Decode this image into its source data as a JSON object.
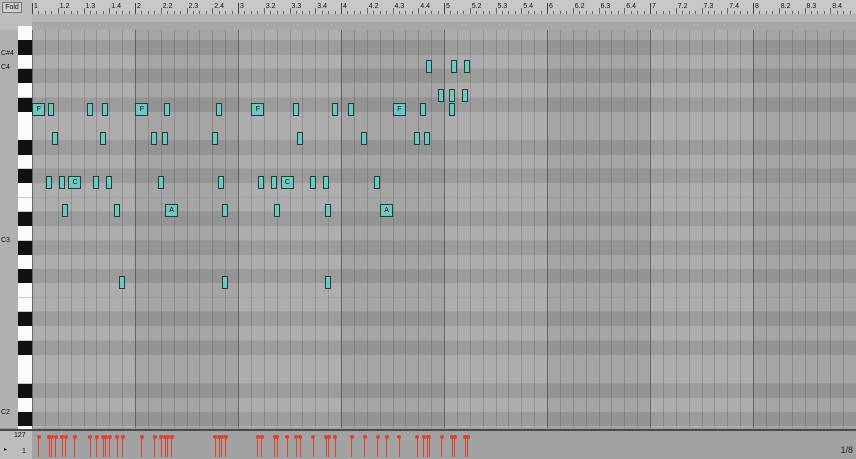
{
  "toolbar": {
    "fold_label": "Fold"
  },
  "ruler": {
    "labels": [
      "1",
      "1.2",
      "1.3",
      "1.4",
      "2",
      "2.2",
      "2.3",
      "2.4",
      "3",
      "3.2",
      "3.3",
      "3.4",
      "4",
      "4.2",
      "4.3",
      "4.4",
      "5",
      "5.2",
      "5.3",
      "5.4",
      "6",
      "6.2",
      "6.3",
      "6.4",
      "7",
      "7.2",
      "7.3",
      "7.4",
      "8",
      "8.2",
      "8.3",
      "8.4"
    ]
  },
  "loop_marker": "+",
  "keyboard": {
    "labels": [
      "C#4",
      "C4",
      "C3",
      "C2"
    ]
  },
  "notes": [
    {
      "beat": 1.25,
      "row": 4,
      "label": "F"
    },
    {
      "beat": 1.75,
      "row": 4,
      "label": ""
    },
    {
      "beat": 3.25,
      "row": 4,
      "label": ""
    },
    {
      "beat": 3.85,
      "row": 4,
      "label": ""
    },
    {
      "beat": 5.25,
      "row": 4,
      "label": "F"
    },
    {
      "beat": 6.25,
      "row": 4,
      "label": ""
    },
    {
      "beat": 8.25,
      "row": 4,
      "label": ""
    },
    {
      "beat": 9.75,
      "row": 4,
      "label": "F"
    },
    {
      "beat": 11.25,
      "row": 4,
      "label": ""
    },
    {
      "beat": 12.75,
      "row": 4,
      "label": ""
    },
    {
      "beat": 13.4,
      "row": 4,
      "label": ""
    },
    {
      "beat": 15.25,
      "row": 4,
      "label": "F"
    },
    {
      "beat": 16.2,
      "row": 4,
      "label": ""
    },
    {
      "beat": 17.3,
      "row": 4,
      "label": ""
    },
    {
      "beat": 1.9,
      "row": 6,
      "label": ""
    },
    {
      "beat": 3.75,
      "row": 6,
      "label": ""
    },
    {
      "beat": 5.75,
      "row": 6,
      "label": ""
    },
    {
      "beat": 6.15,
      "row": 6,
      "label": ""
    },
    {
      "beat": 8.1,
      "row": 6,
      "label": ""
    },
    {
      "beat": 11.4,
      "row": 6,
      "label": ""
    },
    {
      "beat": 13.9,
      "row": 6,
      "label": ""
    },
    {
      "beat": 15.95,
      "row": 6,
      "label": ""
    },
    {
      "beat": 16.35,
      "row": 6,
      "label": ""
    },
    {
      "beat": 1.65,
      "row": 9,
      "label": ""
    },
    {
      "beat": 2.15,
      "row": 9,
      "label": ""
    },
    {
      "beat": 2.65,
      "row": 9,
      "label": "C"
    },
    {
      "beat": 3.5,
      "row": 9,
      "label": ""
    },
    {
      "beat": 4,
      "row": 9,
      "label": ""
    },
    {
      "beat": 6,
      "row": 9,
      "label": ""
    },
    {
      "beat": 8.35,
      "row": 9,
      "label": ""
    },
    {
      "beat": 9.9,
      "row": 9,
      "label": ""
    },
    {
      "beat": 10.4,
      "row": 9,
      "label": ""
    },
    {
      "beat": 10.9,
      "row": 9,
      "label": "C"
    },
    {
      "beat": 11.9,
      "row": 9,
      "label": ""
    },
    {
      "beat": 12.4,
      "row": 9,
      "label": ""
    },
    {
      "beat": 14.4,
      "row": 9,
      "label": ""
    },
    {
      "beat": 2.3,
      "row": 11,
      "label": ""
    },
    {
      "beat": 4.3,
      "row": 11,
      "label": ""
    },
    {
      "beat": 6.4,
      "row": 11,
      "label": "A"
    },
    {
      "beat": 8.5,
      "row": 11,
      "label": ""
    },
    {
      "beat": 10.5,
      "row": 11,
      "label": ""
    },
    {
      "beat": 12.5,
      "row": 11,
      "label": ""
    },
    {
      "beat": 14.75,
      "row": 11,
      "label": "A"
    },
    {
      "beat": 4.5,
      "row": 16,
      "label": ""
    },
    {
      "beat": 8.5,
      "row": 16,
      "label": ""
    },
    {
      "beat": 12.5,
      "row": 16,
      "label": ""
    },
    {
      "beat": 16.4,
      "row": 1,
      "label": ""
    },
    {
      "beat": 17.4,
      "row": 1,
      "label": ""
    },
    {
      "beat": 17.9,
      "row": 1,
      "label": ""
    },
    {
      "beat": 16.9,
      "row": 3,
      "label": ""
    },
    {
      "beat": 17.3,
      "row": 3,
      "label": ""
    },
    {
      "beat": 17.8,
      "row": 3,
      "label": ""
    }
  ],
  "velocity": {
    "max_label": "127",
    "min_label": "1",
    "play_icon": "▸",
    "grid_quantization": "1/8"
  },
  "colors": {
    "note": "#6fc7bf",
    "velocity": "#d9452f"
  }
}
